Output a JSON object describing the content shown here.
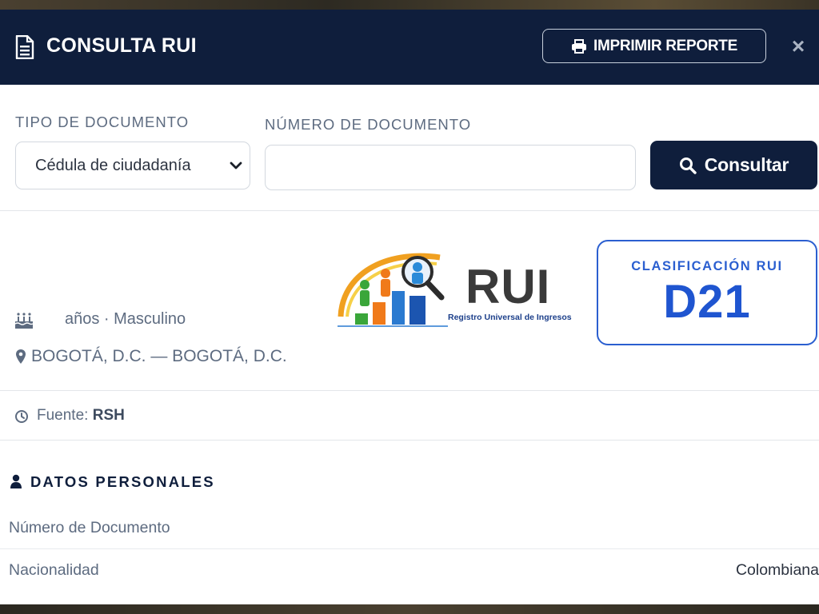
{
  "modal": {
    "title": "CONSULTA RUI",
    "print_label": "IMPRIMIR REPORTE",
    "close_label": "×"
  },
  "search": {
    "doc_type_label": "TIPO DE DOCUMENTO",
    "doc_type_value": "Cédula de ciudadanía",
    "doc_number_label": "NÚMERO DE DOCUMENTO",
    "doc_number_value": "",
    "consult_label": "Consultar"
  },
  "profile": {
    "age_gender": "años · Masculino",
    "location": "BOGOTÁ, D.C. — BOGOTÁ, D.C.",
    "logo_text": "RUI",
    "logo_subtitle": "Registro Universal de Ingresos",
    "classification_label": "CLASIFICACIÓN RUI",
    "classification_value": "D21"
  },
  "source": {
    "label": "Fuente:",
    "value": "RSH"
  },
  "personal": {
    "title": "DATOS PERSONALES",
    "rows": [
      {
        "key": "Número de Documento",
        "value": ""
      },
      {
        "key": "Nacionalidad",
        "value": "Colombiana"
      }
    ]
  },
  "colors": {
    "header_bg": "#0f1e3c",
    "accent_blue": "#2b5fd0",
    "muted_text": "#5d6b80"
  },
  "icons": [
    "document-icon",
    "printer-icon",
    "close-icon",
    "chevron-down-icon",
    "search-icon",
    "birthday-cake-icon",
    "map-pin-icon",
    "clock-icon",
    "user-icon"
  ]
}
